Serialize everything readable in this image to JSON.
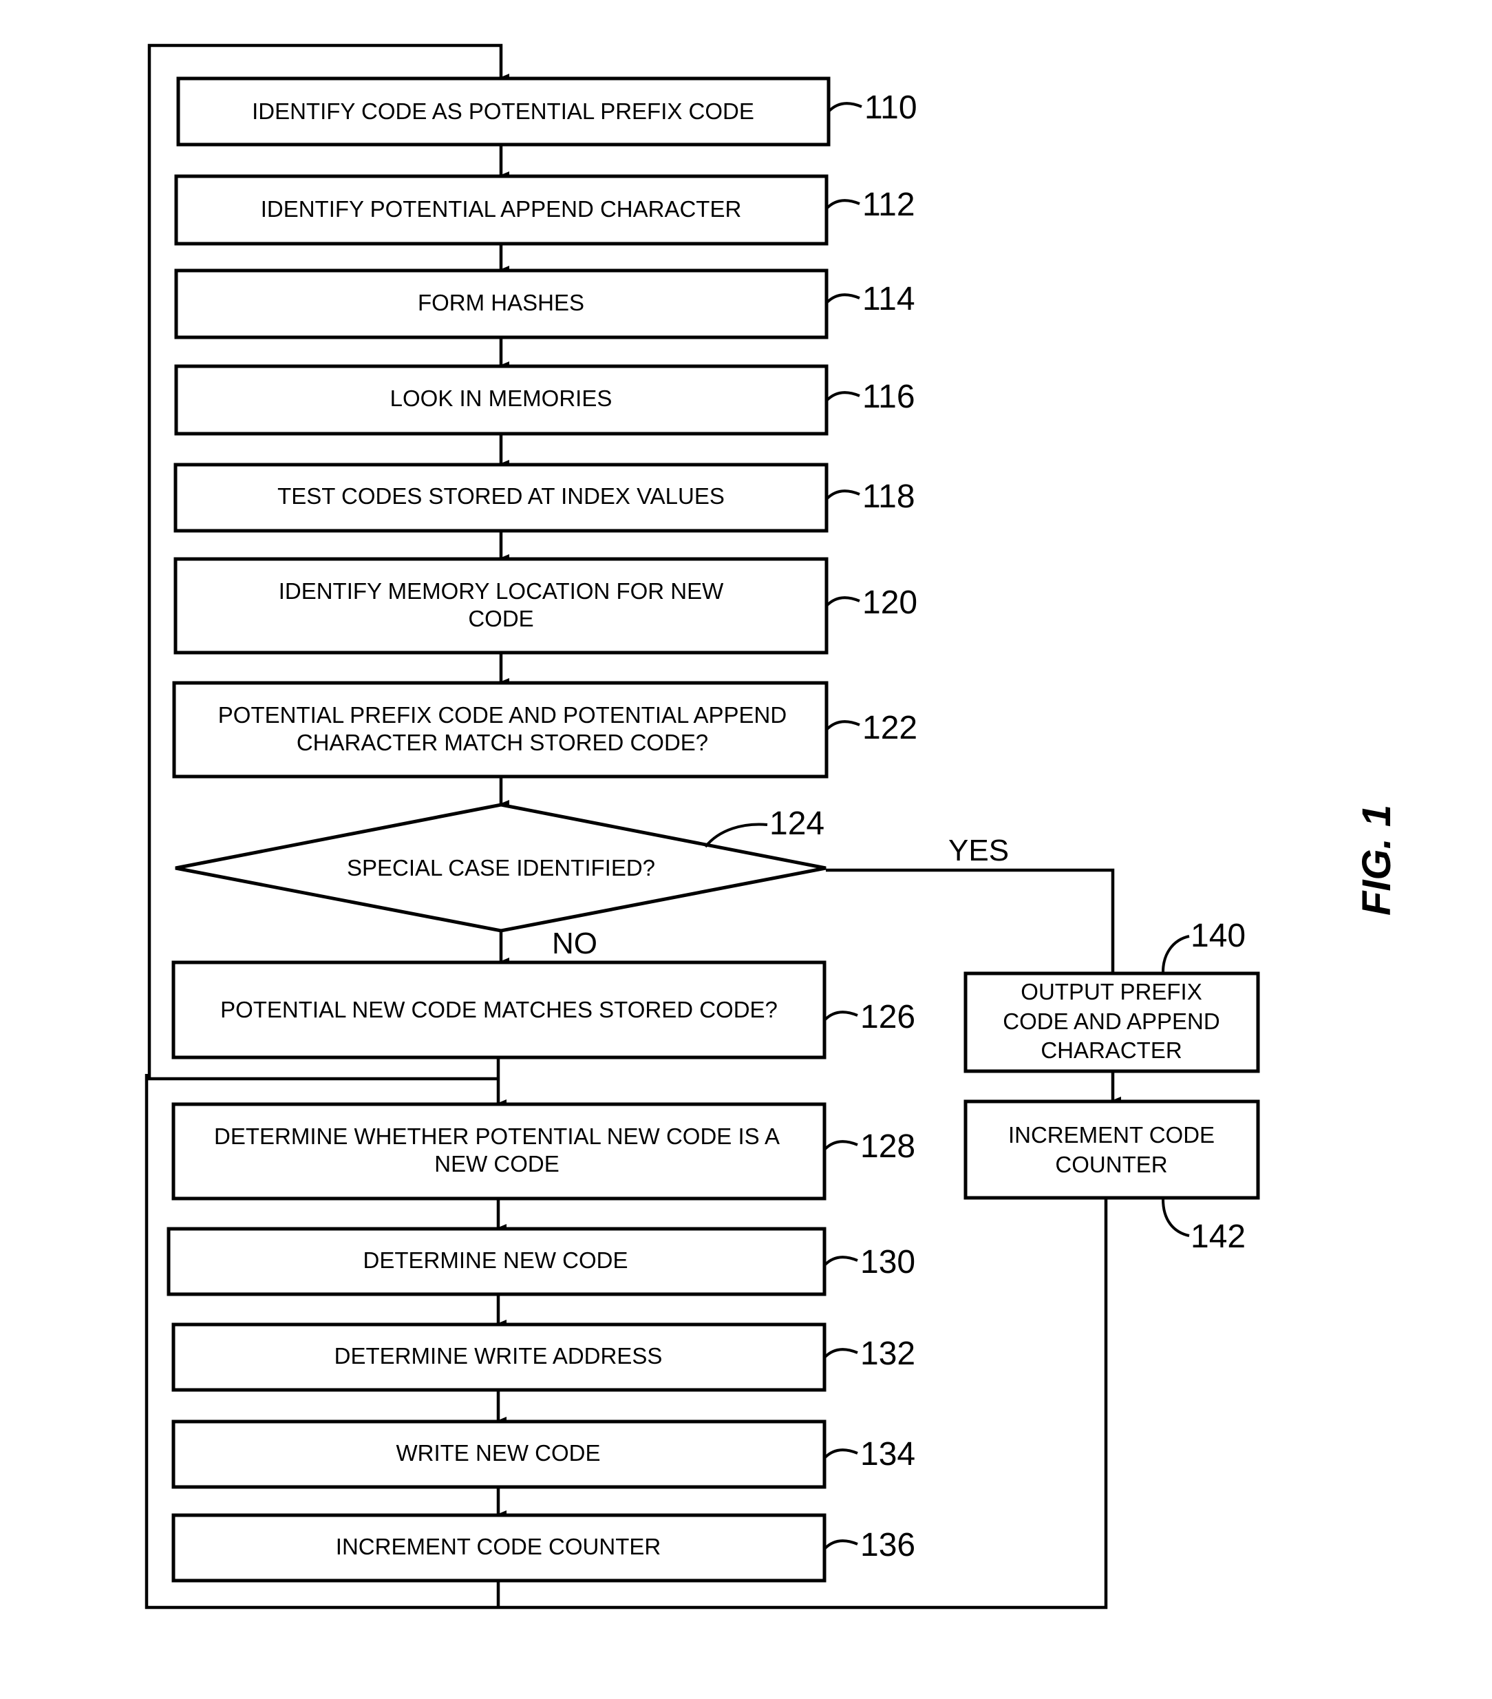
{
  "figure_label": "FIG. 1",
  "steps": {
    "s110": {
      "ref": "110",
      "lines": [
        "IDENTIFY CODE AS POTENTIAL PREFIX CODE"
      ]
    },
    "s112": {
      "ref": "112",
      "lines": [
        "IDENTIFY POTENTIAL APPEND CHARACTER"
      ]
    },
    "s114": {
      "ref": "114",
      "lines": [
        "FORM HASHES"
      ]
    },
    "s116": {
      "ref": "116",
      "lines": [
        "LOOK IN MEMORIES"
      ]
    },
    "s118": {
      "ref": "118",
      "lines": [
        "TEST CODES STORED AT INDEX VALUES"
      ]
    },
    "s120": {
      "ref": "120",
      "lines": [
        "IDENTIFY MEMORY LOCATION FOR NEW",
        "CODE"
      ]
    },
    "s122": {
      "ref": "122",
      "lines": [
        "POTENTIAL PREFIX CODE AND POTENTIAL APPEND",
        "CHARACTER MATCH STORED CODE?"
      ]
    },
    "s124": {
      "ref": "124",
      "lines": [
        "SPECIAL CASE IDENTIFIED?"
      ]
    },
    "s126": {
      "ref": "126",
      "lines": [
        "POTENTIAL NEW CODE MATCHES STORED CODE?"
      ]
    },
    "s128": {
      "ref": "128",
      "lines": [
        "DETERMINE WHETHER POTENTIAL NEW CODE IS A",
        "NEW CODE"
      ]
    },
    "s130": {
      "ref": "130",
      "lines": [
        "DETERMINE NEW CODE"
      ]
    },
    "s132": {
      "ref": "132",
      "lines": [
        "DETERMINE WRITE ADDRESS"
      ]
    },
    "s134": {
      "ref": "134",
      "lines": [
        "WRITE NEW CODE"
      ]
    },
    "s136": {
      "ref": "136",
      "lines": [
        "INCREMENT CODE COUNTER"
      ]
    },
    "s140": {
      "ref": "140",
      "lines": [
        "OUTPUT PREFIX",
        "CODE AND APPEND",
        "CHARACTER"
      ]
    },
    "s142": {
      "ref": "142",
      "lines": [
        "INCREMENT CODE",
        "COUNTER"
      ]
    }
  },
  "branches": {
    "yes": "YES",
    "no": "NO"
  }
}
